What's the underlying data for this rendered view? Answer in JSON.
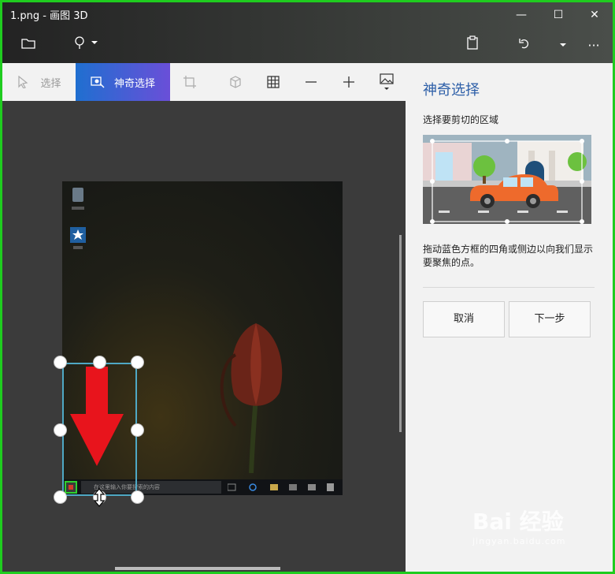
{
  "window": {
    "title": "1.png - 画图 3D",
    "controls": {
      "minimize": "—",
      "maximize": "☐",
      "close": "✕"
    }
  },
  "titlebar": {
    "icons": [
      "folder-icon",
      "pin-icon",
      "chevron-down-icon",
      "paste-icon",
      "undo-icon",
      "chevron-down-icon",
      "more-icon"
    ],
    "more_label": "···"
  },
  "toolbar": {
    "select_label": "选择",
    "magic_select_label": "神奇选择"
  },
  "canvas": {
    "search_placeholder": "在这里输入你要搜索的内容"
  },
  "panel": {
    "title": "神奇选择",
    "subtitle": "选择要剪切的区域",
    "description": "拖动蓝色方框的四角或侧边以向我们显示要聚焦的点。",
    "cancel_label": "取消",
    "next_label": "下一步"
  },
  "watermark": {
    "brand": "Bai 经验",
    "url": "jingyan.baidu.com"
  },
  "colors": {
    "accent": "#2d5fa8",
    "frame": "#1fcc1f",
    "arrow": "#e8141c"
  }
}
